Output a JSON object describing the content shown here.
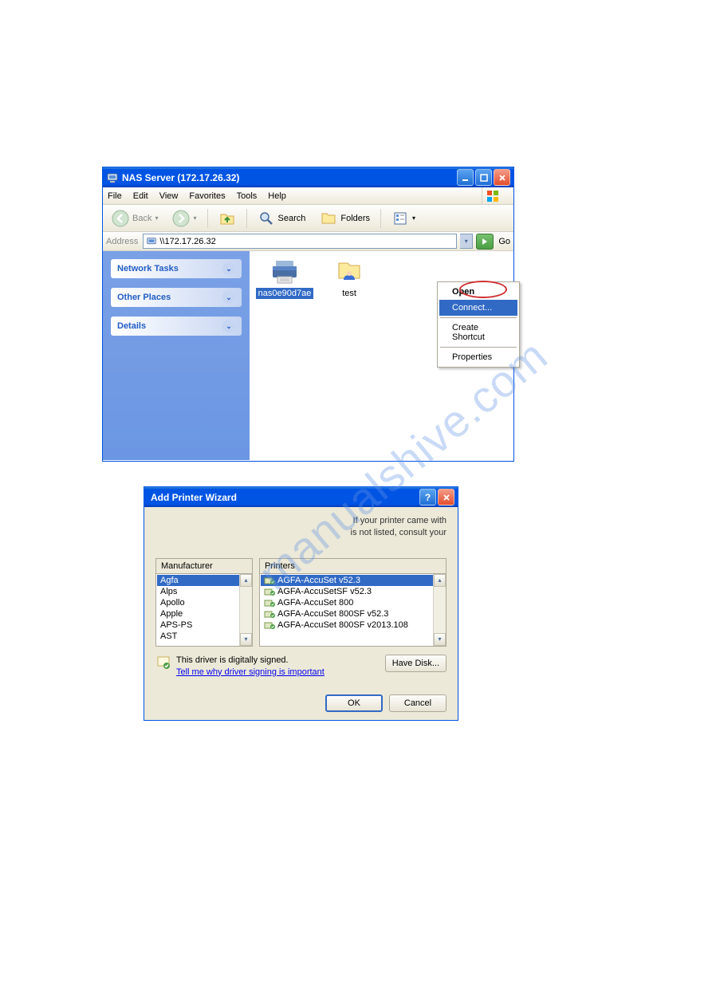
{
  "watermark": "manualshive.com",
  "explorer": {
    "title": "NAS Server (172.17.26.32)",
    "menus": {
      "file": "File",
      "edit": "Edit",
      "view": "View",
      "favorites": "Favorites",
      "tools": "Tools",
      "help": "Help"
    },
    "toolbar": {
      "back": "Back",
      "search": "Search",
      "folders": "Folders"
    },
    "address": {
      "label": "Address",
      "value": "\\\\172.17.26.32",
      "go": "Go"
    },
    "tasks": {
      "network": "Network Tasks",
      "other": "Other Places",
      "details": "Details"
    },
    "items": {
      "printer": "nas0e90d7ae",
      "folder": "test"
    },
    "contextmenu": {
      "open": "Open",
      "connect": "Connect...",
      "shortcut": "Create Shortcut",
      "properties": "Properties"
    }
  },
  "wizard": {
    "title": "Add Printer Wizard",
    "hint1": "If your printer came with",
    "hint2": "is not listed, consult your",
    "mfr_header": "Manufacturer",
    "prn_header": "Printers",
    "manufacturers": [
      "Agfa",
      "Alps",
      "Apollo",
      "Apple",
      "APS-PS",
      "AST"
    ],
    "printers": [
      "AGFA-AccuSet v52.3",
      "AGFA-AccuSetSF v52.3",
      "AGFA-AccuSet 800",
      "AGFA-AccuSet 800SF v52.3",
      "AGFA-AccuSet 800SF v2013.108"
    ],
    "signed": "This driver is digitally signed.",
    "signed_link": "Tell me why driver signing is important",
    "have_disk": "Have Disk...",
    "ok": "OK",
    "cancel": "Cancel"
  }
}
